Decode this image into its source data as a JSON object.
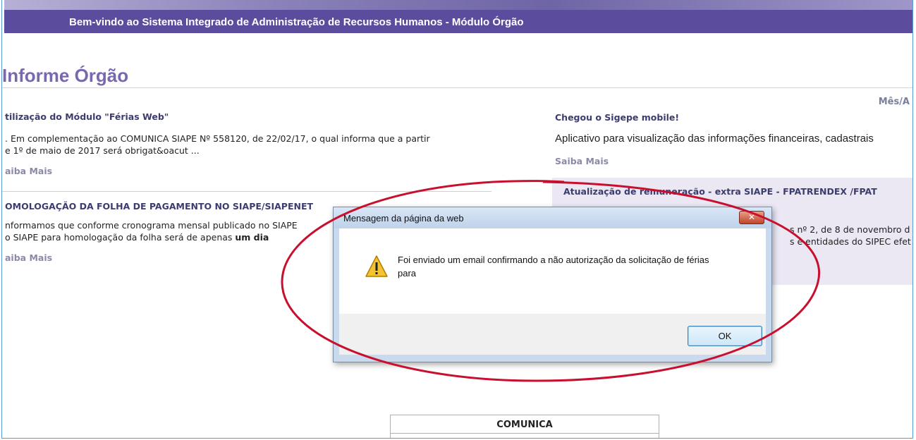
{
  "header": {
    "title": "Bem-vindo ao Sistema Integrado de Administração de Recursos Humanos - Módulo Órgão"
  },
  "page": {
    "title": "Informe Órgão",
    "mes_label": "Mês/A"
  },
  "news_left": [
    {
      "title": "tilização do Módulo \"Férias Web\"",
      "body_lines": [
        ". Em complementação ao COMUNICA SIAPE Nº 558120, de 22/02/17, o qual informa que a partir",
        "e 1º de maio de 2017 será obrigat&oacut ..."
      ],
      "link": "aiba Mais"
    },
    {
      "title": "OMOLOGAÇÃO DA FOLHA DE PAGAMENTO NO SIAPE/SIAPENET",
      "body_lines": [
        "nformamos que  conforme cronograma mensal publicado no SIAPE",
        "o SIAPE para homologação da folha será de apenas "
      ],
      "body_bold": "um dia",
      "link": "aiba Mais"
    }
  ],
  "news_right": {
    "title": "Chegou o Sigepe mobile!",
    "body": "Aplicativo para visualização das informações financeiras, cadastrais",
    "link": "Saiba Mais"
  },
  "highlight": {
    "title": "Atualização de remuneração - extra SIAPE - FPATRENDEX /FPAT",
    "line1": "s nº 2, de 8 de novembro d",
    "line2": "s e entidades do SIPEC efet"
  },
  "comunica": {
    "title": "COMUNICA"
  },
  "dialog": {
    "title": "Mensagem da página da web",
    "close_label": "✕",
    "message": "Foi enviado um email confirmando a não autorização da solicitação de férias para",
    "ok_label": "OK",
    "icon": "warning-icon"
  },
  "colors": {
    "header_bg": "#5c4c9e",
    "title_color": "#7968b1",
    "annotation_red": "#c8102e"
  }
}
